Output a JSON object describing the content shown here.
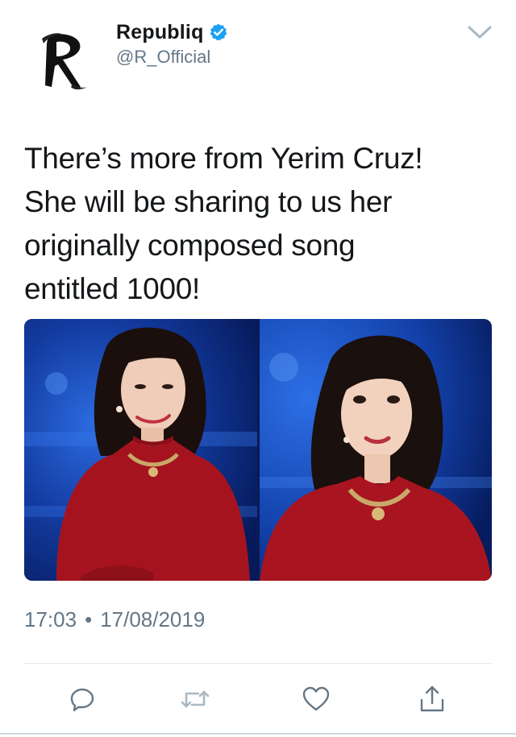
{
  "account": {
    "display_name": "Republiq",
    "handle": "@R_Official",
    "verified": true,
    "avatar_icon": "brush-r-logo-icon"
  },
  "tweet": {
    "text": "There’s more from Yerim Cruz!\nShe will be sharing to us her\noriginally composed song\nentitled 1000!",
    "time": "17:03",
    "separator": "•",
    "date": "17/08/2019"
  },
  "media": {
    "photos": [
      {
        "subject": "woman-in-red-sweater-smiling"
      },
      {
        "subject": "woman-in-red-sweater-looking-up"
      }
    ]
  },
  "actions": [
    {
      "name": "reply-icon"
    },
    {
      "name": "retweet-icon"
    },
    {
      "name": "like-icon"
    },
    {
      "name": "share-icon"
    }
  ],
  "colors": {
    "verified": "#1da1f2",
    "secondary_text": "#657786",
    "icon_gray": "#657786"
  }
}
